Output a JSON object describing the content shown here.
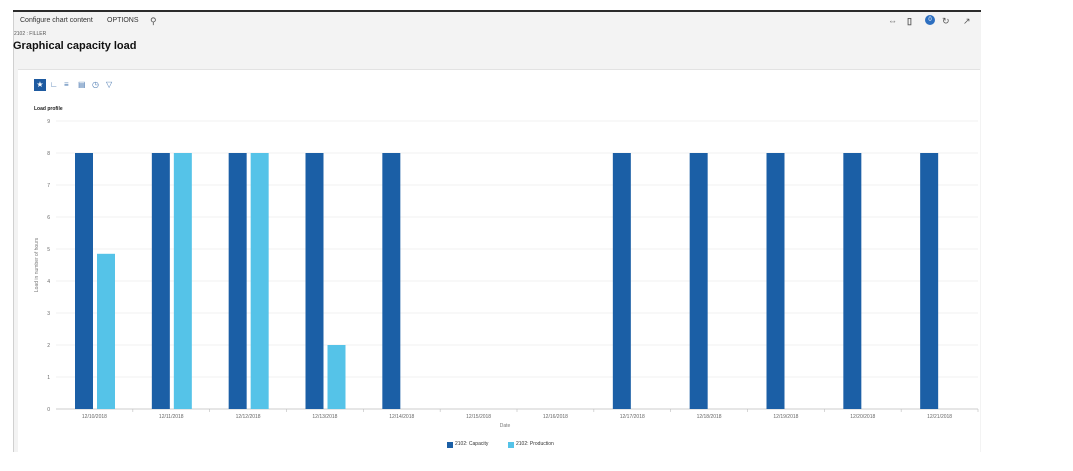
{
  "actionbar": {
    "configure_label": "Configure chart content",
    "options_label": "OPTIONS",
    "notification_count": "0"
  },
  "breadcrumb": "2102 : FILLER",
  "page_title": "Graphical capacity load",
  "chart_toolbar": [
    "star-icon",
    "line-chart-icon",
    "bar-chart-icon",
    "column-chart-icon",
    "pie-chart-icon",
    "filter-icon"
  ],
  "colors": {
    "capacity": "#1b5fa6",
    "production": "#55c3e8",
    "accent": "#1e5aa0"
  },
  "chart_data": {
    "type": "bar",
    "title": "Load profile",
    "xlabel": "Date",
    "ylabel": "Load in number of hours",
    "ylim": [
      0,
      9
    ],
    "yticks": [
      "0",
      "1",
      "2",
      "3",
      "4",
      "5",
      "6",
      "7",
      "8",
      "9"
    ],
    "categories": [
      "12/10/2018",
      "12/11/2018",
      "12/12/2018",
      "12/13/2018",
      "12/14/2018",
      "12/15/2018",
      "12/16/2018",
      "12/17/2018",
      "12/18/2018",
      "12/19/2018",
      "12/20/2018",
      "12/21/2018"
    ],
    "series": [
      {
        "name": "2102: Capacity",
        "values": [
          8,
          8,
          8,
          8,
          8,
          0,
          0,
          8,
          8,
          8,
          8,
          8
        ]
      },
      {
        "name": "2102: Production",
        "values": [
          4.85,
          8,
          8,
          2,
          0,
          0,
          0,
          0,
          0,
          0,
          0,
          0
        ]
      }
    ],
    "grid": true,
    "legend": "bottom"
  }
}
